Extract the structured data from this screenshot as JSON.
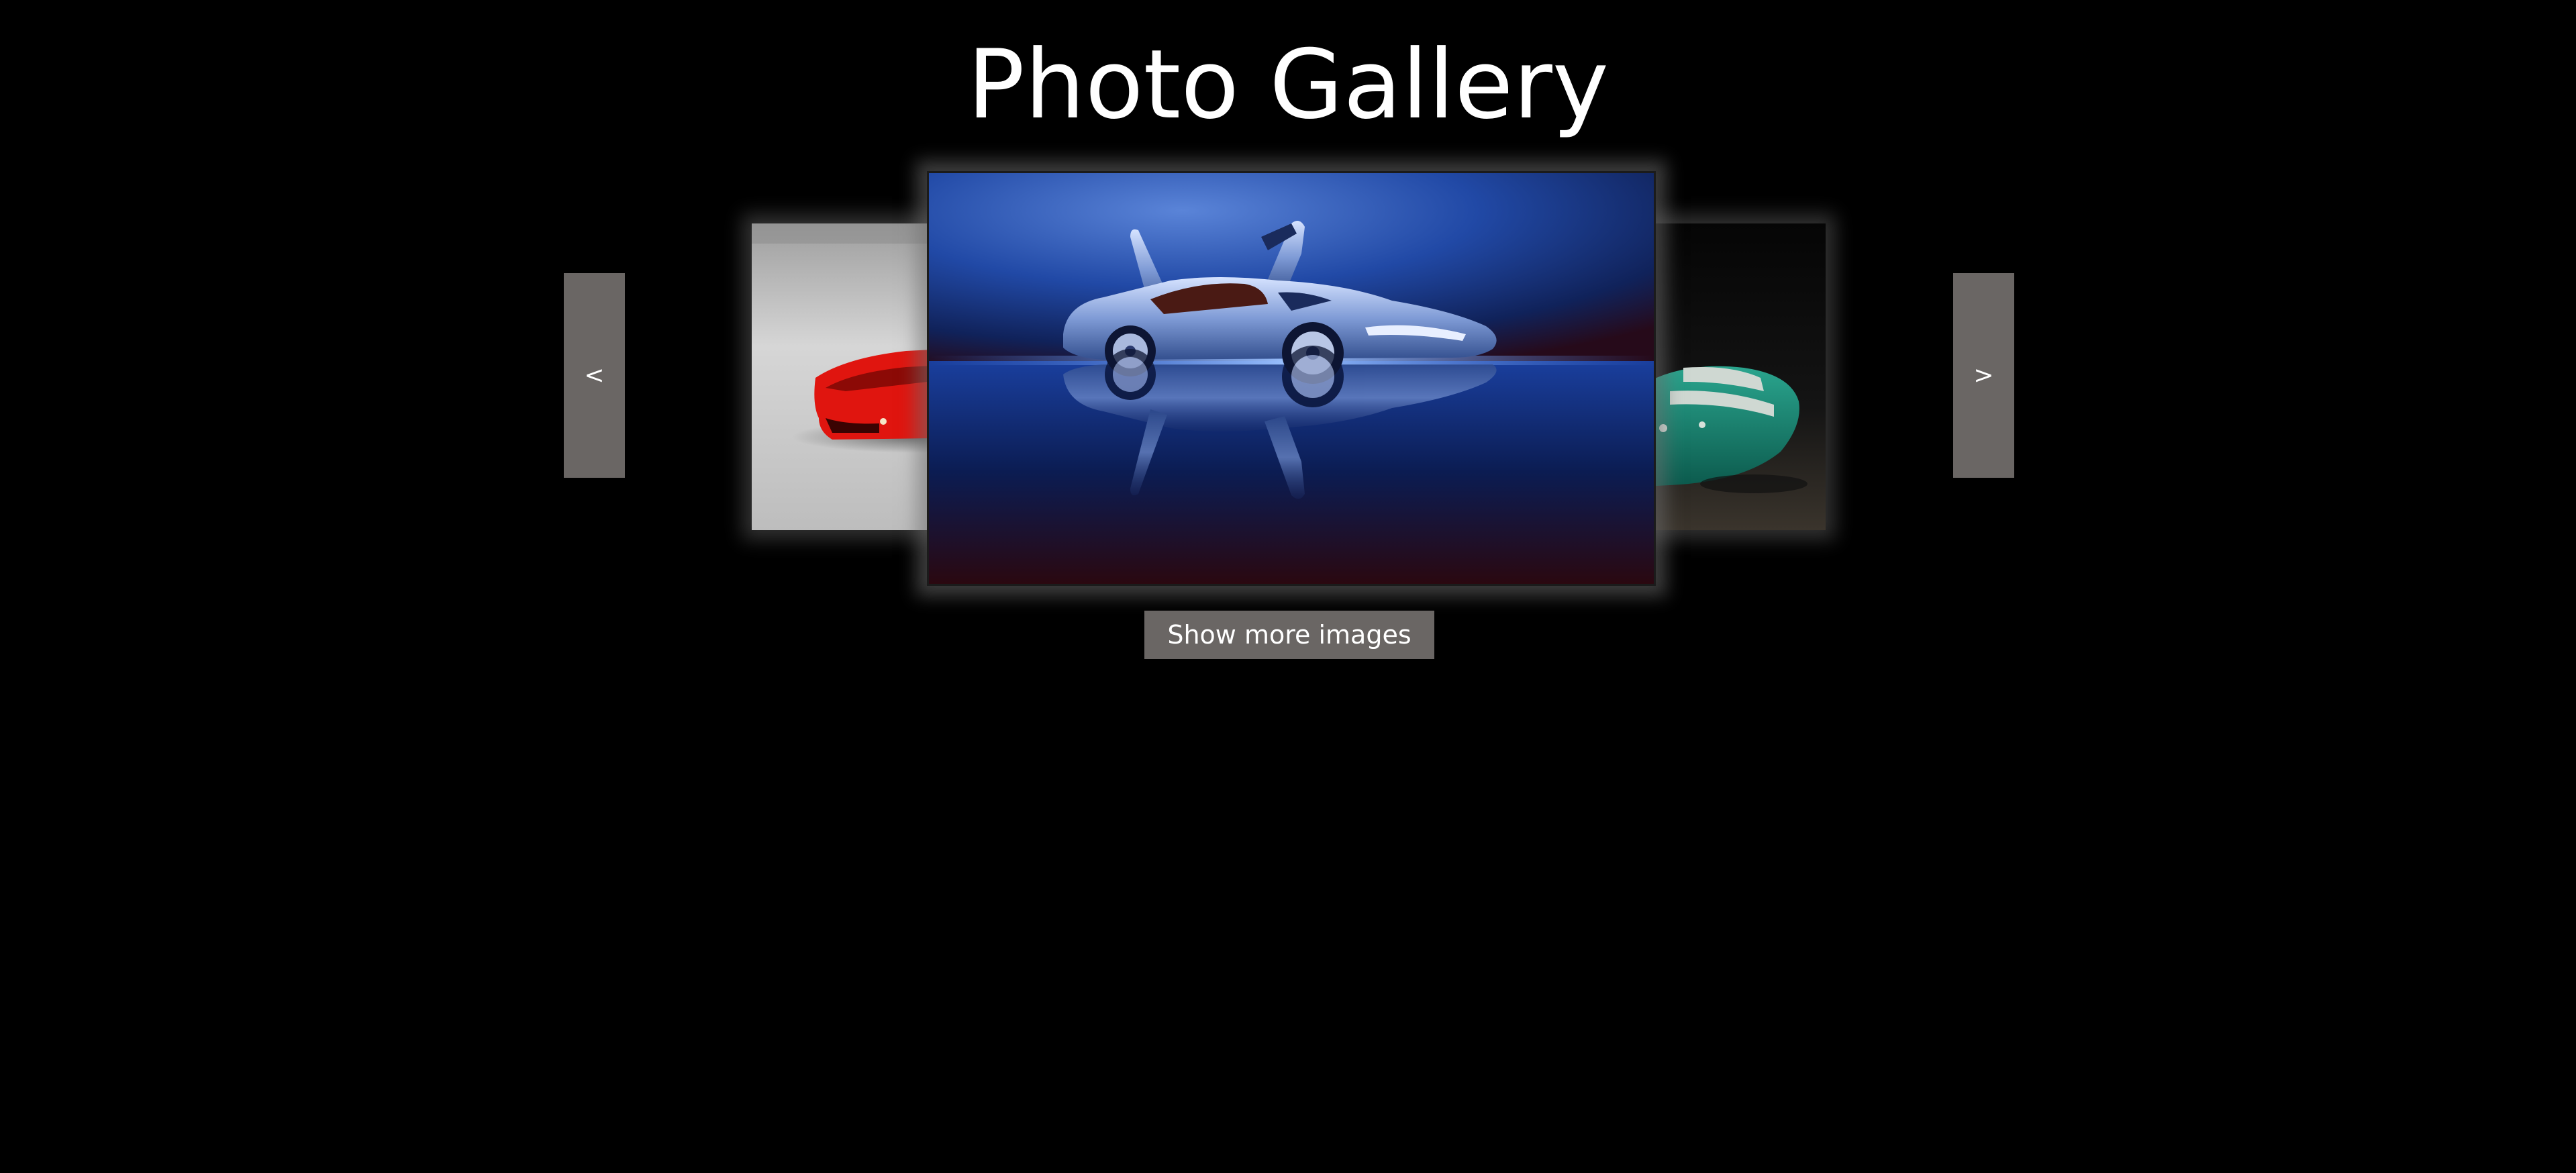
{
  "page": {
    "title": "Photo Gallery"
  },
  "nav": {
    "prev_label": "<",
    "next_label": ">"
  },
  "slides": [
    {
      "position": "left",
      "subject": "red sports car"
    },
    {
      "position": "center",
      "subject": "silver sports car with open doors"
    },
    {
      "position": "right",
      "subject": "green classic race car"
    }
  ],
  "actions": {
    "show_more_label": "Show more images"
  },
  "colors": {
    "background": "#000000",
    "button": "#6a6664",
    "text": "#ffffff"
  }
}
